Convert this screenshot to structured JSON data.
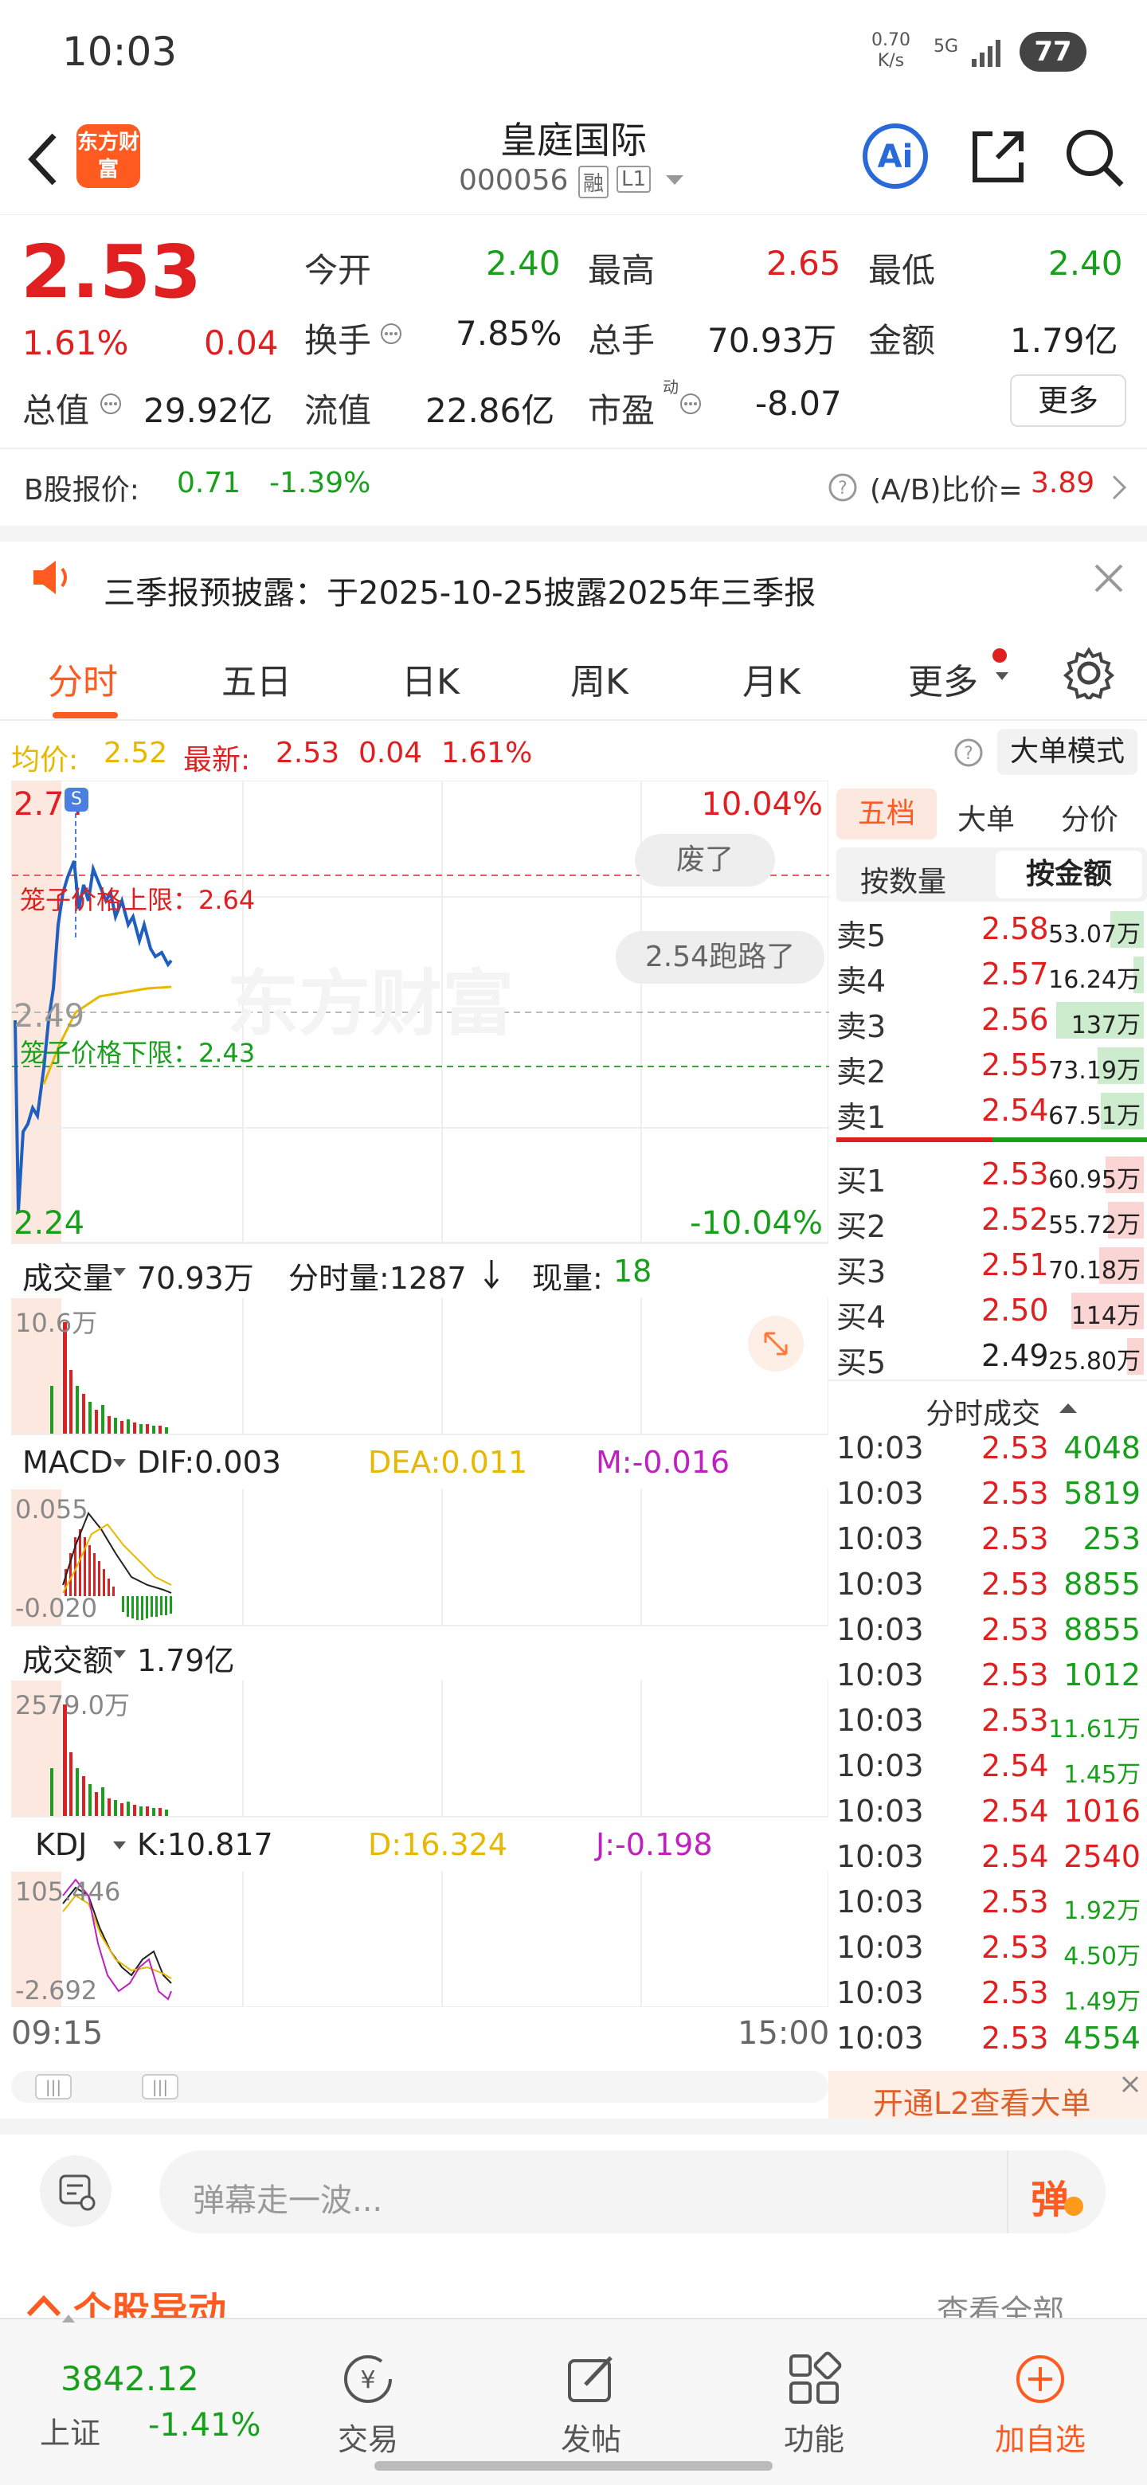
{
  "status": {
    "time": "10:03",
    "net_speed": "0.70\nK/s",
    "net_type": "5G",
    "battery": "77"
  },
  "header": {
    "logo": "东方财富",
    "title": "皇庭国际",
    "code": "000056",
    "badge1": "融",
    "badge2": "L1"
  },
  "quote": {
    "price": "2.53",
    "change_pct": "1.61%",
    "change": "0.04",
    "open_label": "今开",
    "open": "2.40",
    "high_label": "最高",
    "high": "2.65",
    "low_label": "最低",
    "low": "2.40",
    "turnover_label": "换手",
    "turnover": "7.85%",
    "volume_label": "总手",
    "volume": "70.93万",
    "amount_label": "金额",
    "amount": "1.79亿",
    "mktcap_label": "总值",
    "mktcap": "29.92亿",
    "float_label": "流值",
    "float": "22.86亿",
    "pe_label": "市盈",
    "pe_sup": "动",
    "pe": "-8.07",
    "more": "更多"
  },
  "bshare": {
    "label": "B股报价:",
    "price": "0.71",
    "pct": "-1.39%",
    "ratio_label": "(A/B)比价=",
    "ratio": "3.89"
  },
  "notice": {
    "text": "三季报预披露：于2025-10-25披露2025年三季报"
  },
  "tabs": [
    "分时",
    "五日",
    "日K",
    "周K",
    "月K",
    "更多"
  ],
  "avg_line": {
    "avg_label": "均价:",
    "avg": "2.52",
    "latest_label": "最新:",
    "latest": "2.53",
    "chg": "0.04",
    "pct": "1.61%",
    "mode": "大单模式"
  },
  "chart": {
    "y_top": "2.74",
    "y_mid": "2.49",
    "y_bot": "2.24",
    "pct_top": "10.04%",
    "pct_bot": "-10.04%",
    "upper_limit": "笼子价格上限：2.64",
    "lower_limit": "笼子价格下限：2.43",
    "danmu1": "废了",
    "danmu2": "2.54跑路了",
    "watermark": "东方财富",
    "s_badge": "S",
    "t_start": "09:15",
    "t_end": "15:00"
  },
  "vol_panel": {
    "label": "成交量",
    "total": "70.93万",
    "min_label": "分时量:1287",
    "now_label": "现量:",
    "now": "18",
    "ymax": "10.6万"
  },
  "macd_panel": {
    "label": "MACD",
    "dif": "DIF:0.003",
    "dea": "DEA:0.011",
    "m": "M:-0.016",
    "ymax": "0.055",
    "ymin": "-0.020"
  },
  "amt_panel": {
    "label": "成交额",
    "total": "1.79亿",
    "ymax": "2579.0万"
  },
  "kdj_panel": {
    "label": "KDJ",
    "k": "K:10.817",
    "d": "D:16.324",
    "j": "J:-0.198",
    "ymax": "105.446",
    "ymin": "-2.692"
  },
  "order_tabs": {
    "t1": "五档",
    "t2": "大单",
    "t3": "分价",
    "s1": "按数量",
    "s2": "按金额"
  },
  "asks": [
    {
      "k": "卖5",
      "p": "2.58",
      "v": "53.07万"
    },
    {
      "k": "卖4",
      "p": "2.57",
      "v": "16.24万"
    },
    {
      "k": "卖3",
      "p": "2.56",
      "v": "137万"
    },
    {
      "k": "卖2",
      "p": "2.55",
      "v": "73.19万"
    },
    {
      "k": "卖1",
      "p": "2.54",
      "v": "67.51万"
    }
  ],
  "bids": [
    {
      "k": "买1",
      "p": "2.53",
      "v": "60.95万"
    },
    {
      "k": "买2",
      "p": "2.52",
      "v": "55.72万"
    },
    {
      "k": "买3",
      "p": "2.51",
      "v": "70.18万"
    },
    {
      "k": "买4",
      "p": "2.50",
      "v": "114万"
    },
    {
      "k": "买5",
      "p": "2.49",
      "v": "25.80万"
    }
  ],
  "ticks_title": "分时成交",
  "ticks": [
    {
      "t": "10:03",
      "p": "2.53",
      "q": "4048"
    },
    {
      "t": "10:03",
      "p": "2.53",
      "q": "5819"
    },
    {
      "t": "10:03",
      "p": "2.53",
      "q": "253"
    },
    {
      "t": "10:03",
      "p": "2.53",
      "q": "8855"
    },
    {
      "t": "10:03",
      "p": "2.53",
      "q": "8855"
    },
    {
      "t": "10:03",
      "p": "2.53",
      "q": "1012"
    },
    {
      "t": "10:03",
      "p": "2.53",
      "q": "11.61万"
    },
    {
      "t": "10:03",
      "p": "2.54",
      "q": "1.45万"
    },
    {
      "t": "10:03",
      "p": "2.54",
      "q": "1016"
    },
    {
      "t": "10:03",
      "p": "2.54",
      "q": "2540"
    },
    {
      "t": "10:03",
      "p": "2.53",
      "q": "1.92万"
    },
    {
      "t": "10:03",
      "p": "2.53",
      "q": "4.50万"
    },
    {
      "t": "10:03",
      "p": "2.53",
      "q": "1.49万"
    },
    {
      "t": "10:03",
      "p": "2.53",
      "q": "4554"
    }
  ],
  "l2_banner": "开通L2查看大单",
  "comment": {
    "placeholder": "弹幕走一波...",
    "btn": "弹"
  },
  "section": {
    "title": "个股异动",
    "more": "查看全部"
  },
  "bottom_nav": {
    "index_value": "3842.12",
    "index_name": "上证",
    "index_pct": "-1.41%",
    "trade": "交易",
    "post": "发帖",
    "func": "功能",
    "add": "加自选"
  }
}
